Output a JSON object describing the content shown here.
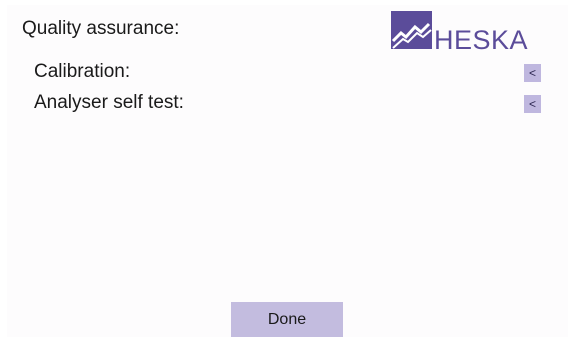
{
  "header": {
    "title": "Quality assurance:"
  },
  "logo": {
    "text": "HESKA",
    "brand_color": "#5b4c9a"
  },
  "rows": [
    {
      "label": "Calibration:",
      "button_label": "<"
    },
    {
      "label": "Analyser self test:",
      "button_label": "<"
    }
  ],
  "footer": {
    "done_label": "Done"
  },
  "colors": {
    "button_bg": "#c3bcdf",
    "text": "#1a1a1a"
  }
}
